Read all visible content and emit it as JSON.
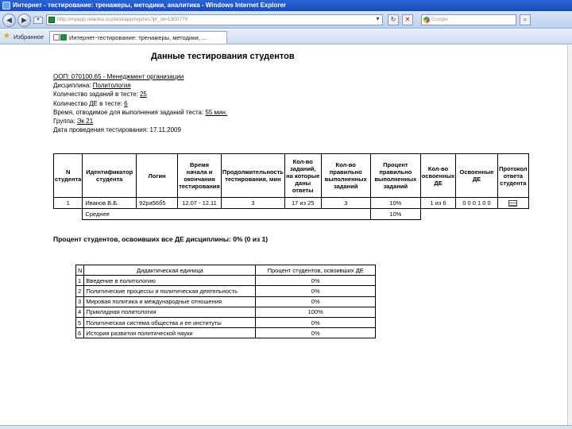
{
  "window": {
    "title": "Интернет - тестирование: тренажеры, методики, аналитика - Windows Internet Explorer",
    "url": "http://myapp.relanka.ru/ptest/app/rep/res?pr_id=1300779",
    "search_placeholder": "Google",
    "favorites_label": "Избранное",
    "tab_title": "Интернет-тестирование: тренажеры, методики, ..."
  },
  "report": {
    "title": "Данные тестирования студентов",
    "info": {
      "ooo": "ООП: 070100.65 - Менеджмент организации",
      "discipline_label": "Дисциплина:",
      "discipline_value": "Политология",
      "tasks_label": "Количество заданий в тесте:",
      "tasks_value": "25",
      "de_label": "Количество ДЕ в тесте:",
      "de_value": "6",
      "time_label": "Время, отводимое для выполнения заданий теста:",
      "time_value": "55 мин.",
      "group_label": "Группа:",
      "group_value": "Эк 21",
      "date_text": "Дата проведения тестирования: 17.11.2009"
    },
    "results_table": {
      "headers": [
        "N студента",
        "Идентификатор студента",
        "Логин",
        "Время начала и окончания тестирования",
        "Продолжительность тестирования, мин",
        "Кол-во заданий, на которые даны ответы",
        "Кол-во правильно выполненных заданий",
        "Процент правильно выполненных заданий",
        "Кол-во освоенных ДЕ",
        "Освоенные ДЕ",
        "Протокол ответа студента"
      ],
      "rows": [
        {
          "n": "1",
          "id": "Иванов В.Б.",
          "login": "92ра56б5",
          "time": "12.07 - 12.11",
          "duration": "3",
          "answered": "17 из 25",
          "correct": "3",
          "percent": "10%",
          "de_count": "1 из 6",
          "de_list": "0 0 0 1 0 0",
          "protocol_icon": "document-icon"
        }
      ],
      "average_label": "Среднее",
      "average_percent": "10%"
    },
    "summary": "Процент студентов, освоивших все ДЕ дисциплины: 0% (0 из 1)",
    "de_table": {
      "headers": [
        "N",
        "Дидактическая единица",
        "Процент студентов, освоивших ДЕ"
      ],
      "rows": [
        {
          "n": "1",
          "name": "Введение в политологию",
          "pct": "0%"
        },
        {
          "n": "2",
          "name": "Политические процессы и политическая деятельность",
          "pct": "0%"
        },
        {
          "n": "3",
          "name": "Мировая политика и международные отношения",
          "pct": "0%"
        },
        {
          "n": "4",
          "name": "Прикладная политология",
          "pct": "100%"
        },
        {
          "n": "5",
          "name": "Политическая система общества и ее институты",
          "pct": "0%"
        },
        {
          "n": "6",
          "name": "История развития политической науки",
          "pct": "0%"
        }
      ]
    }
  }
}
